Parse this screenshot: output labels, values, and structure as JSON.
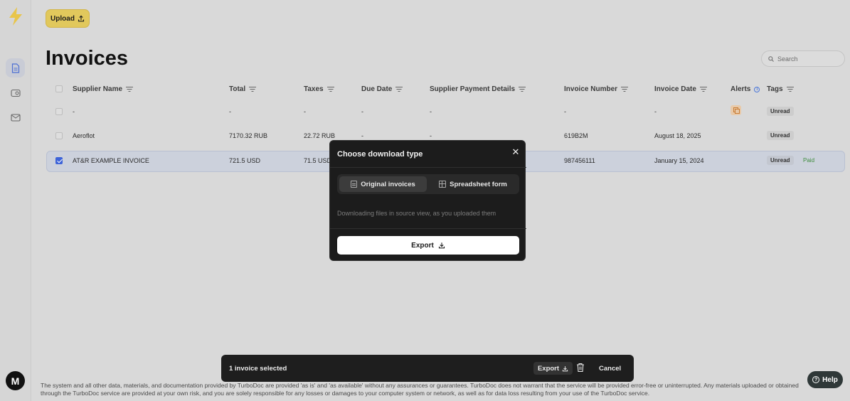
{
  "header": {
    "upload_label": "Upload",
    "page_title": "Invoices",
    "search_placeholder": "Search"
  },
  "sidebar": {
    "items": [
      {
        "icon": "document-icon",
        "active": true
      },
      {
        "icon": "wallet-icon",
        "active": false
      },
      {
        "icon": "mail-icon",
        "active": false
      }
    ],
    "avatar_initial": "M"
  },
  "table": {
    "columns": [
      "Supplier Name",
      "Total",
      "Taxes",
      "Due Date",
      "Supplier Payment Details",
      "Invoice Number",
      "Invoice Date",
      "Alerts",
      "Tags"
    ],
    "rows": [
      {
        "supplier": "-",
        "total": "-",
        "taxes": "-",
        "due_date": "-",
        "payment_details": "-",
        "invoice_number": "-",
        "invoice_date": "-",
        "alert": true,
        "tags": [
          "Unread"
        ],
        "selected": false
      },
      {
        "supplier": "Aeroflot",
        "total": "7170.32 RUB",
        "taxes": "22.72 RUB",
        "due_date": "-",
        "payment_details": "-",
        "invoice_number": "619B2M",
        "invoice_date": "August 18, 2025",
        "alert": false,
        "tags": [
          "Unread"
        ],
        "selected": false
      },
      {
        "supplier": "AT&R EXAMPLE INVOICE",
        "total": "721.5 USD",
        "taxes": "71.5 USD",
        "due_date": "",
        "payment_details": "",
        "invoice_number": "987456111",
        "invoice_date": "January 15, 2024",
        "alert": false,
        "tags": [
          "Unread",
          "Paid"
        ],
        "selected": true
      }
    ]
  },
  "modal": {
    "title": "Choose download type",
    "options": [
      "Original invoices",
      "Spreadsheet form"
    ],
    "active_option": "Original invoices",
    "description": "Downloading files in source view, as you uploaded them",
    "export_label": "Export"
  },
  "selection_bar": {
    "count_text": "1 invoice selected",
    "export_label": "Export",
    "cancel_label": "Cancel"
  },
  "footer": {
    "text": "The system and all other data, materials, and documentation provided by TurboDoc are provided 'as is' and 'as available' without any assurances or guarantees. TurboDoc does not warrant that the service will be provided error-free or uninterrupted. Any materials uploaded or obtained through the TurboDoc service are provided at your own risk, and you are solely responsible for any losses or damages to your computer system or network, as well as for data loss resulting from your use of the TurboDoc service."
  },
  "help_label": "Help",
  "colors": {
    "accent_yellow": "#e1c85c",
    "checkbox_blue": "#3d63d8",
    "paid_green": "#3f8d3f"
  }
}
